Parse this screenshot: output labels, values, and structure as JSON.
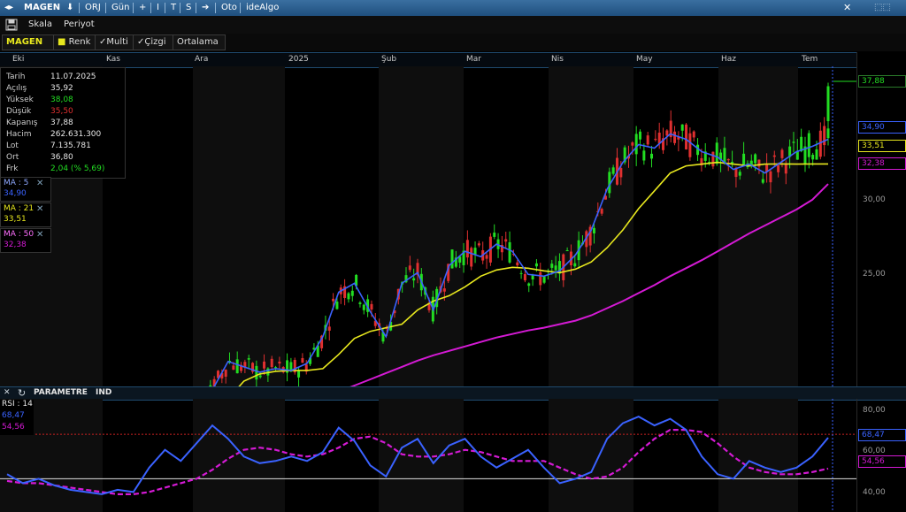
{
  "titlebar": {
    "symbol": "MAGEN",
    "orj": "ORJ",
    "period": "Gün",
    "plus": "+",
    "bar": "I",
    "t": "T",
    "s": "S",
    "arrow": "➔",
    "auto": "Oto",
    "brand": "ideAlgo",
    "close": "✕"
  },
  "menubar": {
    "scale": "Skala",
    "period": "Periyot"
  },
  "tabs": {
    "symbol": "MAGEN",
    "color": "Renk",
    "multi": "Multi",
    "draw": "Çizgi",
    "average": "Ortalama"
  },
  "colors": {
    "up": "#22dd22",
    "down": "#e03030",
    "ma5": "#3a62ff",
    "ma21": "#e8e81e",
    "ma50": "#d41ad4",
    "rsi": "#3a62ff",
    "rsi_sig": "#d41ad4",
    "accent": "#1f4a6e",
    "price": "#22dd22"
  },
  "dates": [
    "Eki",
    "Kas",
    "Ara",
    "2025",
    "Şub",
    "Mar",
    "Nis",
    "May",
    "Haz",
    "Tem"
  ],
  "info": {
    "rows": [
      {
        "k": "Tarih",
        "v": "11.07.2025",
        "c": "#e6e6e6"
      },
      {
        "k": "Açılış",
        "v": "35,92",
        "c": "#e6e6e6"
      },
      {
        "k": "Yüksek",
        "v": "38,08",
        "c": "#22dd22"
      },
      {
        "k": "Düşük",
        "v": "35,50",
        "c": "#e03030"
      },
      {
        "k": "Kapanış",
        "v": "37,88",
        "c": "#e6e6e6"
      },
      {
        "k": "Hacim",
        "v": "262.631.300",
        "c": "#e6e6e6"
      },
      {
        "k": "Lot",
        "v": "7.135.781",
        "c": "#e6e6e6"
      },
      {
        "k": "Ort",
        "v": "36,80",
        "c": "#e6e6e6"
      },
      {
        "k": "Frk",
        "v": "2,04 (% 5,69)",
        "c": "#22dd22"
      }
    ]
  },
  "ma": [
    {
      "label": "MA : 5",
      "value": "34,90",
      "color": "#3a62ff"
    },
    {
      "label": "MA : 21",
      "value": "33,51",
      "color": "#e8e81e"
    },
    {
      "label": "MA : 50",
      "value": "32,38",
      "color": "#d41ad4"
    }
  ],
  "price_axis": {
    "ticks": [
      "30,00",
      "25,00"
    ],
    "last": "37,88",
    "ma5": "34,90",
    "ma21": "33,51",
    "ma50": "32,38"
  },
  "param": {
    "title": "PARAMETRE",
    "ind": "IND",
    "close": "✕",
    "refresh": "↻"
  },
  "rsi": {
    "label": "RSI : 14",
    "v1": "68,47",
    "v2": "54,56",
    "ticks": [
      "80,00",
      "60,00",
      "40,00"
    ],
    "upper": 70,
    "lower": 50
  },
  "chart_data": {
    "type": "line",
    "xlabel": "",
    "ylabel": "",
    "ylim": [
      21,
      39
    ],
    "series": [
      {
        "name": "MA : 50",
        "values": [
          18.6,
          18.45,
          18.4,
          18.35,
          18.3,
          18.2,
          18.05,
          17.9,
          17.8,
          17.75,
          17.7,
          17.75,
          17.9,
          18.2,
          18.5,
          18.8,
          19.1,
          19.45,
          19.8,
          20.1,
          20.4,
          20.7,
          21.05,
          21.4,
          21.75,
          22.1,
          22.45,
          22.75,
          23.0,
          23.25,
          23.5,
          23.75,
          23.95,
          24.15,
          24.3,
          24.5,
          24.7,
          25.0,
          25.4,
          25.8,
          26.25,
          26.7,
          27.2,
          27.65,
          28.1,
          28.6,
          29.1,
          29.6,
          30.05,
          30.5,
          30.95,
          31.5,
          32.38
        ]
      },
      {
        "name": "MA : 21",
        "values": [
          18.8,
          18.4,
          18.2,
          18.3,
          18.0,
          17.7,
          17.5,
          17.3,
          17.2,
          17.3,
          17.6,
          17.8,
          18.2,
          19.0,
          20.3,
          21.3,
          21.7,
          21.85,
          21.9,
          21.9,
          22.0,
          22.8,
          23.7,
          24.1,
          24.3,
          24.5,
          25.3,
          25.8,
          26.1,
          26.6,
          27.2,
          27.55,
          27.7,
          27.65,
          27.5,
          27.4,
          27.6,
          28.0,
          28.8,
          29.8,
          31.0,
          32.0,
          33.0,
          33.4,
          33.5,
          33.6,
          33.5,
          33.4,
          33.5,
          33.51,
          33.5,
          33.51,
          33.51
        ]
      },
      {
        "name": "MA : 5",
        "values": [
          18.2,
          18.1,
          18.0,
          18.4,
          17.8,
          17.5,
          17.2,
          17.1,
          17.3,
          17.9,
          18.1,
          17.6,
          18.8,
          20.8,
          22.4,
          22.1,
          21.8,
          22.0,
          21.9,
          22.3,
          23.8,
          26.3,
          26.8,
          25.2,
          23.8,
          26.8,
          27.4,
          25.3,
          27.8,
          28.6,
          28.3,
          29.0,
          28.6,
          27.3,
          27.2,
          27.5,
          28.4,
          29.8,
          32.1,
          33.6,
          34.6,
          34.4,
          35.2,
          34.9,
          34.2,
          33.9,
          33.2,
          33.5,
          33.0,
          33.6,
          34.2,
          34.5,
          34.9
        ]
      },
      {
        "name": "RSI : 14",
        "values": [
          52,
          48,
          50,
          47,
          45,
          44,
          43,
          45,
          44,
          55,
          63,
          58,
          66,
          74,
          68,
          60,
          57,
          58,
          60,
          58,
          62,
          73,
          67,
          56,
          51,
          64,
          68,
          57,
          65,
          68,
          60,
          55,
          59,
          63,
          55,
          48,
          50,
          53,
          68,
          75,
          78,
          74,
          77,
          72,
          60,
          52,
          50,
          58,
          55,
          53,
          55,
          60,
          68.47
        ]
      },
      {
        "name": "",
        "values": [
          49,
          48,
          48,
          47,
          46,
          45,
          44,
          43,
          43,
          44,
          46,
          48,
          50,
          54,
          59,
          63,
          64,
          63,
          61,
          60,
          61,
          64,
          68,
          69,
          66,
          61,
          60,
          60,
          61,
          63,
          62,
          60,
          58,
          58,
          58,
          55,
          52,
          50,
          51,
          55,
          62,
          68,
          72,
          72,
          71,
          66,
          60,
          55,
          53,
          52,
          52,
          53,
          54.56
        ]
      }
    ]
  }
}
